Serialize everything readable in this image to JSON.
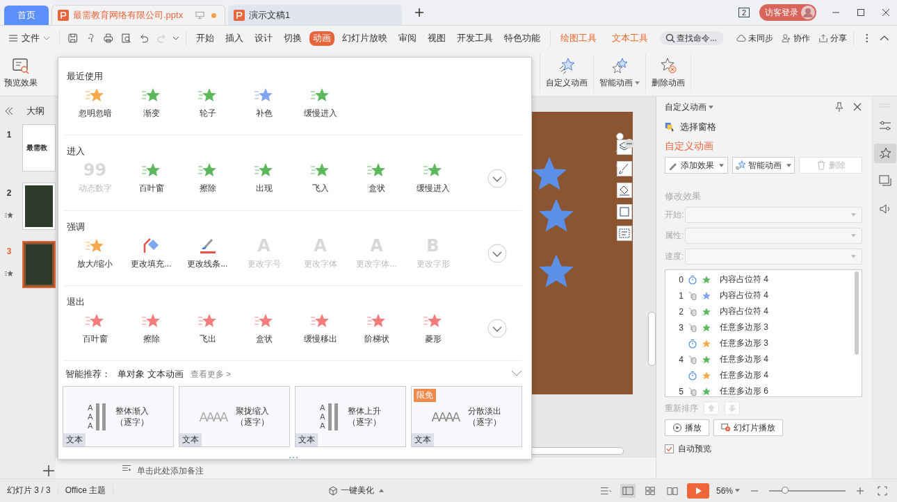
{
  "title_bar": {
    "tabs": [
      {
        "label": "首页",
        "kind": "home",
        "selected": false
      },
      {
        "label": "最需教育网络有限公司.pptx",
        "kind": "doc",
        "selected": true,
        "unsaved": true
      },
      {
        "label": "演示文稿1",
        "kind": "doc",
        "selected": false,
        "unsaved": false
      }
    ],
    "window_count": "2",
    "login": "访客登录"
  },
  "menu": {
    "file": "文件",
    "tabs": [
      {
        "label": "开始",
        "kind": "normal",
        "selected": false
      },
      {
        "label": "插入",
        "kind": "normal",
        "selected": false
      },
      {
        "label": "设计",
        "kind": "normal",
        "selected": false
      },
      {
        "label": "切换",
        "kind": "normal",
        "selected": false
      },
      {
        "label": "动画",
        "kind": "normal",
        "selected": true
      },
      {
        "label": "幻灯片放映",
        "kind": "normal",
        "selected": false
      },
      {
        "label": "审阅",
        "kind": "normal",
        "selected": false
      },
      {
        "label": "视图",
        "kind": "normal",
        "selected": false
      },
      {
        "label": "开发工具",
        "kind": "normal",
        "selected": false
      },
      {
        "label": "特色功能",
        "kind": "normal",
        "selected": false
      },
      {
        "label": "绘图工具",
        "kind": "context",
        "selected": false
      },
      {
        "label": "文本工具",
        "kind": "context",
        "selected": false
      }
    ],
    "search": {
      "placeholder": "查找命令..."
    },
    "actions": [
      {
        "label": "未同步",
        "kind": "sync"
      },
      {
        "label": "协作",
        "kind": "share-user"
      },
      {
        "label": "分享",
        "kind": "share"
      }
    ]
  },
  "ribbon": {
    "preview": "预览效果",
    "tools": [
      {
        "label": "自定义动画",
        "kind": "custom",
        "dropdown": false
      },
      {
        "label": "智能动画",
        "kind": "smart",
        "dropdown": true
      },
      {
        "label": "删除动画",
        "kind": "delete",
        "dropdown": false
      }
    ]
  },
  "sidebar": {
    "tab": "大纲",
    "slides": [
      {
        "number": "1",
        "selected": false,
        "animated": false,
        "kind": "title",
        "caption": "最需教"
      },
      {
        "number": "2",
        "selected": false,
        "animated": true,
        "kind": "photo"
      },
      {
        "number": "3",
        "selected": true,
        "animated": true,
        "kind": "photo"
      }
    ]
  },
  "notes": {
    "placeholder": "单击此处添加备注"
  },
  "animation_gallery": {
    "sections": [
      {
        "title": "最近使用",
        "expandable": false,
        "items": [
          {
            "label": "忽明忽暗",
            "kind": "star",
            "color": "#f7a94b",
            "disabled": false
          },
          {
            "label": "渐变",
            "kind": "star",
            "color": "#5cb85c",
            "disabled": false
          },
          {
            "label": "轮子",
            "kind": "star",
            "color": "#5cb85c",
            "disabled": false
          },
          {
            "label": "补色",
            "kind": "star",
            "color": "#7ea6ef",
            "disabled": false
          },
          {
            "label": "缓慢进入",
            "kind": "star",
            "color": "#5cb85c",
            "disabled": false
          }
        ]
      },
      {
        "title": "进入",
        "expandable": true,
        "items": [
          {
            "label": "动态数字",
            "kind": "glyph",
            "glyph": "99",
            "color": "#d8d8d8",
            "disabled": true
          },
          {
            "label": "百叶窗",
            "kind": "star",
            "color": "#5cb85c",
            "disabled": false
          },
          {
            "label": "擦除",
            "kind": "star",
            "color": "#5cb85c",
            "disabled": false
          },
          {
            "label": "出现",
            "kind": "star",
            "color": "#5cb85c",
            "disabled": false
          },
          {
            "label": "飞入",
            "kind": "star",
            "color": "#5cb85c",
            "disabled": false
          },
          {
            "label": "盒状",
            "kind": "star",
            "color": "#5cb85c",
            "disabled": false
          },
          {
            "label": "缓慢进入",
            "kind": "star",
            "color": "#5cb85c",
            "disabled": false
          }
        ]
      },
      {
        "title": "强调",
        "expandable": true,
        "items": [
          {
            "label": "放大/缩小",
            "kind": "star",
            "color": "#f7a94b",
            "disabled": false
          },
          {
            "label": "更改填充...",
            "kind": "fill",
            "color": "#7ea6ef",
            "disabled": false
          },
          {
            "label": "更改线条...",
            "kind": "line",
            "color": "#e8534f",
            "disabled": false
          },
          {
            "label": "更改字号",
            "kind": "glyph",
            "glyph": "A",
            "color": "#d8d8d8",
            "disabled": true
          },
          {
            "label": "更改字体",
            "kind": "glyph",
            "glyph": "A",
            "color": "#d8d8d8",
            "disabled": true
          },
          {
            "label": "更改字体...",
            "kind": "glyph",
            "glyph": "A",
            "color": "#d8d8d8",
            "disabled": true
          },
          {
            "label": "更改字形",
            "kind": "glyph",
            "glyph": "B",
            "color": "#d8d8d8",
            "disabled": true
          }
        ]
      },
      {
        "title": "退出",
        "expandable": true,
        "items": [
          {
            "label": "百叶窗",
            "kind": "star",
            "color": "#f47c7c",
            "disabled": false
          },
          {
            "label": "擦除",
            "kind": "star",
            "color": "#f47c7c",
            "disabled": false
          },
          {
            "label": "飞出",
            "kind": "star",
            "color": "#f47c7c",
            "disabled": false
          },
          {
            "label": "盒状",
            "kind": "star",
            "color": "#f47c7c",
            "disabled": false
          },
          {
            "label": "缓慢移出",
            "kind": "star",
            "color": "#f47c7c",
            "disabled": false
          },
          {
            "label": "阶梯状",
            "kind": "star",
            "color": "#f47c7c",
            "disabled": false
          },
          {
            "label": "菱形",
            "kind": "star",
            "color": "#f47c7c",
            "disabled": false
          }
        ]
      }
    ],
    "recommend": {
      "label": "智能推荐：",
      "filter": "单对象 文本动画",
      "more": "查看更多 >",
      "cards": [
        {
          "title": "整体渐入",
          "subtitle": "（逐字）",
          "tag": "文本",
          "sample": "AAA",
          "kind": "stack"
        },
        {
          "title": "聚拢缩入",
          "subtitle": "（逐字）",
          "tag": "文本",
          "sample": "AAAA",
          "kind": "row"
        },
        {
          "title": "整体上升",
          "subtitle": "（逐字）",
          "tag": "文本",
          "sample": "AAA",
          "kind": "stack"
        },
        {
          "title": "分散淡出",
          "subtitle": "（逐字）",
          "tag": "文本",
          "sample": "AAAA",
          "kind": "row",
          "badge": "限免"
        }
      ]
    }
  },
  "pane": {
    "title": "自定义动画",
    "select_pane": "选择窗格",
    "heading": "自定义动画",
    "buttons": [
      {
        "label": "添加效果",
        "kind": "add",
        "disabled": false
      },
      {
        "label": "智能动画",
        "kind": "smart",
        "disabled": false
      },
      {
        "label": "删除",
        "kind": "delete",
        "disabled": true
      }
    ],
    "modify_title": "修改效果",
    "fields": [
      {
        "label": "开始:"
      },
      {
        "label": "属性:"
      },
      {
        "label": "速度:"
      }
    ],
    "animations": [
      {
        "order": "0",
        "kind": "timer",
        "color": "#5cb85c",
        "name": "内容占位符 4"
      },
      {
        "order": "1",
        "kind": "click",
        "color": "#7ea6ef",
        "name": "内容占位符 4"
      },
      {
        "order": "2",
        "kind": "click",
        "color": "#5cb85c",
        "name": "内容占位符 4"
      },
      {
        "order": "3",
        "kind": "click",
        "color": "#5cb85c",
        "name": "任意多边形 3"
      },
      {
        "kind": "timer",
        "color": "#f7a94b",
        "name": "任意多边形 3"
      },
      {
        "order": "4",
        "kind": "click",
        "color": "#5cb85c",
        "name": "任意多边形 4"
      },
      {
        "kind": "timer",
        "color": "#f7a94b",
        "name": "任意多边形 4"
      },
      {
        "order": "5",
        "kind": "click",
        "color": "#5cb85c",
        "name": "任意多边形 6"
      }
    ],
    "reorder": "重新排序",
    "play": "播放",
    "slideshow": "幻灯片播放",
    "auto_preview": {
      "label": "自动预览",
      "checked": true
    }
  },
  "status_bar": {
    "slide": "幻灯片 3 / 3",
    "theme": "Office 主题",
    "beautify": "一键美化",
    "zoom": "56%",
    "zoom_slider": {
      "level": 0.21
    }
  }
}
